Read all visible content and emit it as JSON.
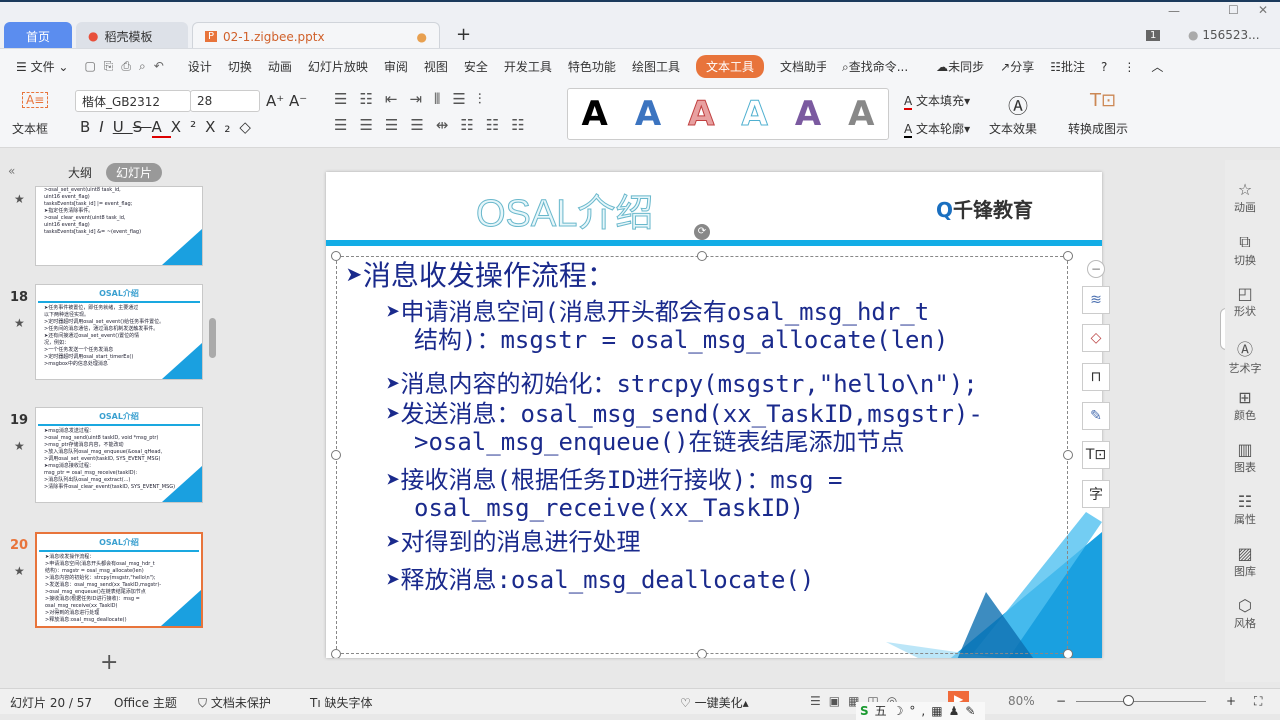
{
  "tabs": [
    {
      "label": "首页"
    },
    {
      "label": "稻壳模板"
    },
    {
      "label": "02-1.zigbee.pptx"
    }
  ],
  "window": {
    "badge": "1",
    "user": "156523..."
  },
  "menu": {
    "file": "文件",
    "items": [
      "设计",
      "切换",
      "动画",
      "幻灯片放映",
      "审阅",
      "视图",
      "安全",
      "开发工具",
      "特色功能",
      "绘图工具",
      "文本工具",
      "文档助手"
    ],
    "active": "文本工具",
    "search": "查找命令...",
    "sync": "未同步",
    "share": "分享",
    "comment": "批注"
  },
  "ribbon": {
    "textbox": "文本框",
    "font": "楷体_GB2312",
    "size": "28",
    "fill": "文本填充",
    "outline": "文本轮廓",
    "effect": "文本效果",
    "convert": "转换成图示"
  },
  "left_panel": {
    "tab_outline": "大纲",
    "tab_slides": "幻灯片",
    "thumbs": [
      {
        "num": "",
        "title": "",
        "lines": [
          ">osal_set_event(uint8 task_id,",
          "uint16 event_flag)",
          "tasksEvents[task_id] |= event_flag;",
          "",
          "➤指定任务清除事件。",
          ">osal_clear_event(uint8 task_id,",
          "uint16 event_flag)",
          "tasksEvents[task_id] &= ~(event_flag)"
        ]
      },
      {
        "num": "18",
        "title": "OSAL介绍",
        "lines": [
          "➤任务事件被置位，即任务就绪，主要通过",
          "以下两种途径实现。",
          ">定时器超时调用osal_set_event()给任务事件置位。",
          ">任务间的消息通信，通过消息机制发送触发事件。",
          "➤还有间接通过osal_set_event()置位的情",
          "况，例如：",
          ">一个任务发送一个任务发消息",
          ">定时器超时调用osal_start_timerEx()",
          ">msgbox中的信息处理消息"
        ]
      },
      {
        "num": "19",
        "title": "OSAL介绍",
        "lines": [
          "➤msg消息发送过程：",
          ">osal_msg_send(uint8 taskID, void *msg_ptr)",
          ">msg_ptr存储消息内容，不能改动",
          ">放入消息队列osal_msg_enqueue(&osal_qHead,",
          ">调用osal_set_event(taskID, SYS_EVENT_MSG)",
          "➤msg消息接收过程：",
          "msg_ptr = osal_msg_receive(taskID):",
          ">消息队列出队osal_msg_extract(...)",
          ">清除事件osal_clear_event(taskID, SYS_EVENT_MSG)"
        ]
      },
      {
        "num": "20",
        "title": "OSAL介绍",
        "lines": [
          "➤消息收发操作流程：",
          ">申请消息空间(消息开头都会有osal_msg_hdr_t",
          "结构)：msgstr = osal_msg_allocate(len)",
          ">消息内容的初始化：strcpy(msgstr,\"hello\\n\");",
          ">发送消息：osal_msg_send(xx_TaskID,msgstr)-",
          ">osal_msg_enqueue()在链表结尾添加节点",
          ">接收消息(根据任务ID进行接收)：msg =",
          "osal_msg_receive(xx_TaskID)",
          ">对得到的消息进行处理",
          ">释放消息:osal_msg_deallocate()"
        ]
      }
    ]
  },
  "slide": {
    "title": "OSAL介绍",
    "logo": "千锋教育",
    "heading": "消息收发操作流程：",
    "bullets": [
      {
        "lines": [
          "申请消息空间(消息开头都会有osal_msg_hdr_t",
          "结构)：msgstr = osal_msg_allocate(len)"
        ]
      },
      {
        "lines": [
          "消息内容的初始化：strcpy(msgstr,\"hello\\n\");"
        ]
      },
      {
        "lines": [
          "发送消息：osal_msg_send(xx_TaskID,msgstr)-",
          ">osal_msg_enqueue()在链表结尾添加节点"
        ]
      },
      {
        "lines": [
          "接收消息(根据任务ID进行接收)：msg =",
          "osal_msg_receive(xx_TaskID)"
        ]
      },
      {
        "lines": [
          "对得到的消息进行处理"
        ]
      },
      {
        "lines": [
          "释放消息:osal_msg_deallocate()"
        ]
      }
    ]
  },
  "right_sidebar": [
    {
      "icon": "star-icon",
      "label": "动画"
    },
    {
      "icon": "switch-icon",
      "label": "切换"
    },
    {
      "icon": "shape-icon",
      "label": "形状"
    },
    {
      "icon": "art-text-icon",
      "label": "艺术字"
    },
    {
      "icon": "color-icon",
      "label": "颜色"
    },
    {
      "icon": "chart-icon",
      "label": "图表"
    },
    {
      "icon": "property-icon",
      "label": "属性"
    },
    {
      "icon": "gallery-icon",
      "label": "图库"
    },
    {
      "icon": "style-icon",
      "label": "风格"
    }
  ],
  "status": {
    "slide": "幻灯片 20 / 57",
    "theme": "Office 主题",
    "protect": "文档未保护",
    "font": "缺失字体",
    "beautify": "一键美化",
    "zoom": "80%"
  },
  "colors": {
    "accent": "#e8743b",
    "tab_home": "#5b8def",
    "slide_text": "#1a2a8c",
    "slide_bar": "#13ade6"
  }
}
